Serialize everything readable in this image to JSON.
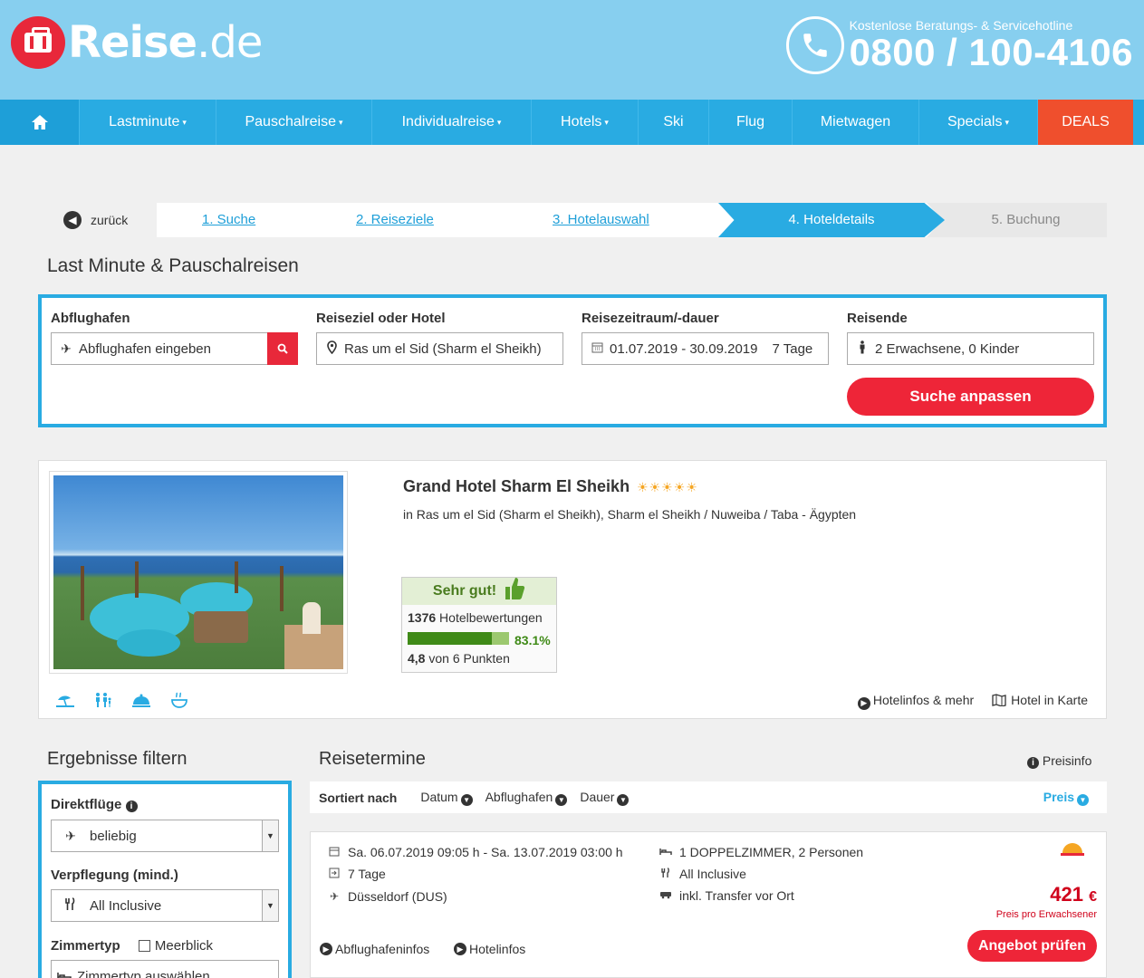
{
  "brand": {
    "logo_main": "Reise",
    "logo_suffix": ".de"
  },
  "hotline": {
    "label": "Kostenlose Beratungs- & Servicehotline",
    "number": "0800 / 100-4106"
  },
  "nav": {
    "items": [
      {
        "label": "Lastminute",
        "dropdown": true
      },
      {
        "label": "Pauschalreise",
        "dropdown": true
      },
      {
        "label": "Individualreise",
        "dropdown": true
      },
      {
        "label": "Hotels",
        "dropdown": true
      },
      {
        "label": "Ski",
        "dropdown": false
      },
      {
        "label": "Flug",
        "dropdown": false
      },
      {
        "label": "Mietwagen",
        "dropdown": false
      },
      {
        "label": "Specials",
        "dropdown": true
      },
      {
        "label": "DEALS",
        "dropdown": false
      }
    ],
    "caret": "▾"
  },
  "steps": {
    "back": "zurück",
    "items": [
      "1. Suche",
      "2. Reiseziele",
      "3. Hotelauswahl",
      "4. Hoteldetails",
      "5. Buchung"
    ],
    "active_index": 3
  },
  "search": {
    "title": "Last Minute & Pauschalreisen",
    "departure": {
      "label": "Abflughafen",
      "placeholder": "Abflughafen eingeben"
    },
    "destination": {
      "label": "Reiseziel oder Hotel",
      "value": "Ras um el Sid (Sharm el Sheikh)"
    },
    "period": {
      "label": "Reisezeitraum/-dauer",
      "value": "01.07.2019 - 30.09.2019",
      "duration": "7 Tage"
    },
    "travelers": {
      "label": "Reisende",
      "value": "2 Erwachsene, 0 Kinder"
    },
    "submit": "Suche anpassen"
  },
  "hotel": {
    "name": "Grand Hotel Sharm El Sheikh",
    "stars": "☀☀☀☀☀",
    "star_count": 5,
    "location": "in Ras um el Sid (Sharm el Sheikh), Sharm el Sheikh / Nuweiba / Taba - Ägypten",
    "rating": {
      "headline": "Sehr gut!",
      "reviews_count": "1376",
      "reviews_label": "Hotelbewertungen",
      "percent": "83.1%",
      "percent_value": 83.1,
      "score": "4,8",
      "score_label": "von 6 Punkten"
    },
    "links": {
      "info": "Hotelinfos & mehr",
      "map": "Hotel in Karte"
    },
    "amenity_icons": [
      "beach-icon",
      "family-icon",
      "service-bell-icon",
      "spa-icon"
    ]
  },
  "filters": {
    "title": "Ergebnisse filtern",
    "direct_flights": {
      "label": "Direktflüge",
      "value": "beliebig"
    },
    "board": {
      "label": "Verpflegung (mind.)",
      "value": "All Inclusive"
    },
    "room_type": {
      "label": "Zimmertyp",
      "checkbox_label": "Meerblick",
      "placeholder": "Zimmertyp auswählen"
    }
  },
  "results": {
    "title": "Reisetermine",
    "price_info": "Preisinfo",
    "sort": {
      "label": "Sortiert nach",
      "options": [
        "Datum",
        "Abflughafen",
        "Dauer"
      ],
      "active": "Preis"
    }
  },
  "offer": {
    "dates": "Sa. 06.07.2019 09:05 h - Sa. 13.07.2019 03:00 h",
    "duration": "7 Tage",
    "departure": "Düsseldorf (DUS)",
    "room": "1 DOPPELZIMMER, 2 Personen",
    "board": "All Inclusive",
    "transfer": "inkl. Transfer vor Ort",
    "price": "421",
    "currency": "€",
    "price_label": "Preis pro Erwachsener",
    "links": {
      "airport": "Abflughafeninfos",
      "hotel": "Hotelinfos"
    },
    "button": "Angebot prüfen"
  },
  "colors": {
    "accent": "#29abe2",
    "brand_red": "#e8283a",
    "header_bg": "#87cfef",
    "deals": "#ef4f2d",
    "rating_green": "#3f8a17"
  }
}
